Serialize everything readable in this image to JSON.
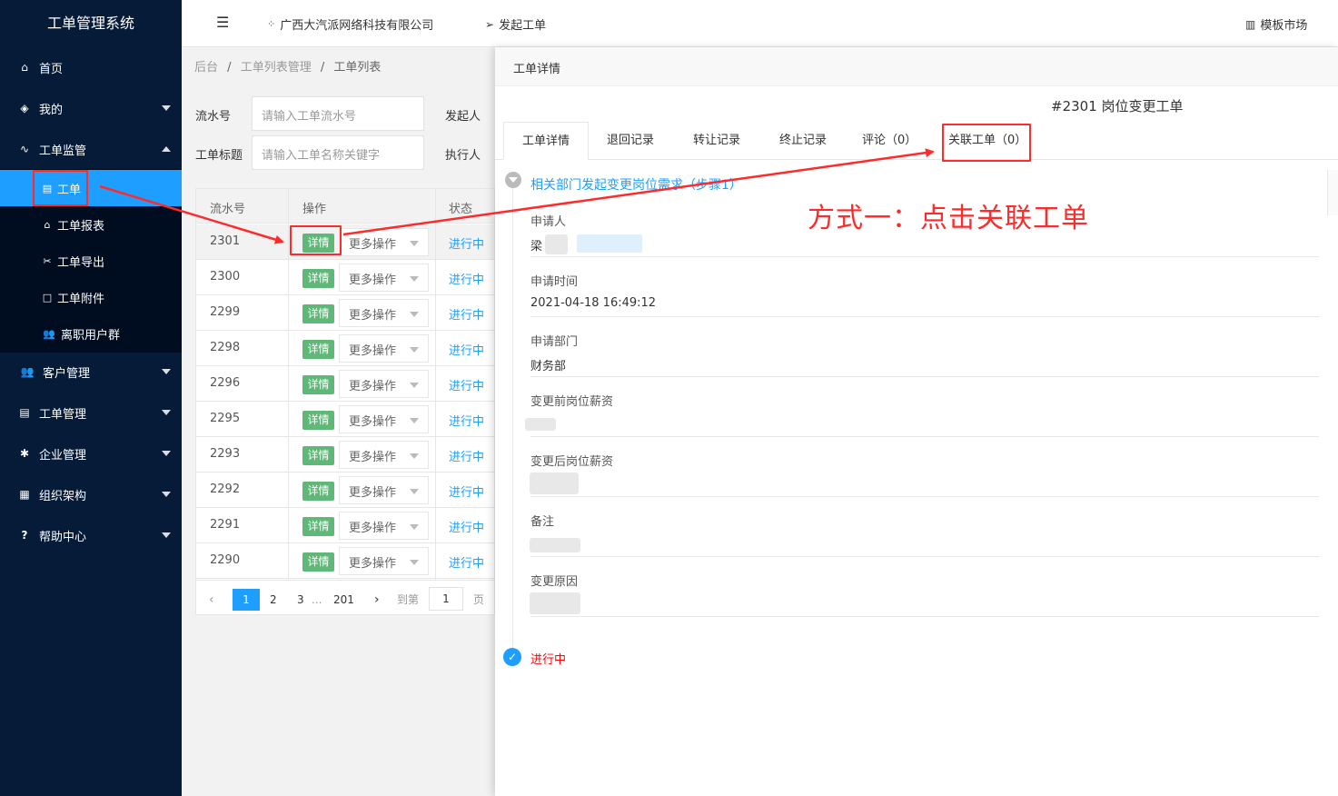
{
  "app": {
    "title": "工单管理系统"
  },
  "sidebar": {
    "items": [
      {
        "label": "首页",
        "icon": "home-icon"
      },
      {
        "label": "我的",
        "icon": "layers-icon"
      },
      {
        "label": "工单监管",
        "icon": "pulse-icon"
      },
      {
        "label": "客户管理",
        "icon": "users-icon"
      },
      {
        "label": "工单管理",
        "icon": "clipboard-icon"
      },
      {
        "label": "企业管理",
        "icon": "gear-icon"
      },
      {
        "label": "组织架构",
        "icon": "calendar-icon"
      },
      {
        "label": "帮助中心",
        "icon": "help-icon"
      }
    ],
    "subitems": [
      {
        "label": "工单",
        "icon": "file-icon"
      },
      {
        "label": "工单报表",
        "icon": "home-icon"
      },
      {
        "label": "工单导出",
        "icon": "tools-icon"
      },
      {
        "label": "工单附件",
        "icon": "file-icon"
      },
      {
        "label": "离职用户群",
        "icon": "users-icon"
      }
    ]
  },
  "topbar": {
    "company": "广西大汽派网络科技有限公司",
    "launch": "发起工单",
    "market": "模板市场"
  },
  "breadcrumb": {
    "root": "后台",
    "mid": "工单列表管理",
    "current": "工单列表",
    "sep": "/"
  },
  "filters": {
    "serial_label": "流水号",
    "serial_placeholder": "请输入工单流水号",
    "title_label": "工单标题",
    "title_placeholder": "请输入工单名称关键字",
    "initiator_label": "发起人",
    "executor_label": "执行人"
  },
  "table": {
    "headers": [
      "流水号",
      "操作",
      "状态"
    ],
    "detail_label": "详情",
    "more_label": "更多操作",
    "rows": [
      {
        "id": "2301",
        "status": "进行中"
      },
      {
        "id": "2300",
        "status": "进行中"
      },
      {
        "id": "2299",
        "status": "进行中"
      },
      {
        "id": "2298",
        "status": "进行中"
      },
      {
        "id": "2296",
        "status": "进行中"
      },
      {
        "id": "2295",
        "status": "进行中"
      },
      {
        "id": "2293",
        "status": "进行中"
      },
      {
        "id": "2292",
        "status": "进行中"
      },
      {
        "id": "2291",
        "status": "进行中"
      },
      {
        "id": "2290",
        "status": "进行中"
      }
    ]
  },
  "pagination": {
    "pages": [
      "1",
      "2",
      "3"
    ],
    "ellipsis": "...",
    "last": "201",
    "goto": "到第",
    "input": "1",
    "unit": "页"
  },
  "detail": {
    "header": "工单详情",
    "title": "#2301 岗位变更工单",
    "tabs": [
      "工单详情",
      "退回记录",
      "转让记录",
      "终止记录",
      "评论（0）",
      "关联工单（0）"
    ],
    "step": "相关部门发起变更岗位需求（步骤1）",
    "fields": [
      {
        "label": "申请人",
        "value": "梁"
      },
      {
        "label": "申请时间",
        "value": "2021-04-18 16:49:12"
      },
      {
        "label": "申请部门",
        "value": "财务部"
      },
      {
        "label": "变更前岗位薪资",
        "value": ""
      },
      {
        "label": "变更后岗位薪资",
        "value": ""
      },
      {
        "label": "备注",
        "value": ""
      },
      {
        "label": "变更原因",
        "value": ""
      }
    ],
    "status": "进行中"
  },
  "annotation": {
    "text": "方式一：点击关联工单",
    "color": "#ff2a2a"
  },
  "colors": {
    "sidebar": "#061b38",
    "accent": "#1e9fff",
    "success": "#5fb878"
  }
}
